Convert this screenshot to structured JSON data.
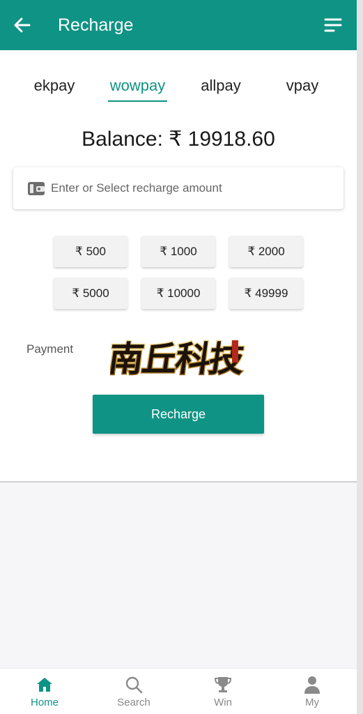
{
  "header": {
    "title": "Recharge",
    "back_icon": "arrow-left-icon",
    "menu_icon": "menu-lines-icon"
  },
  "tabs": [
    {
      "label": "ekpay",
      "active": false
    },
    {
      "label": "wowpay",
      "active": true
    },
    {
      "label": "allpay",
      "active": false
    },
    {
      "label": "vpay",
      "active": false
    }
  ],
  "balance": "Balance: ₹ 19918.60",
  "amount_input": {
    "placeholder": "Enter or Select recharge amount",
    "value": "",
    "icon": "wallet-icon"
  },
  "presets": [
    "₹ 500",
    "₹ 1000",
    "₹ 2000",
    "₹ 5000",
    "₹ 10000",
    "₹ 49999"
  ],
  "payment": {
    "label": "Payment",
    "logo_text": "南丘科技"
  },
  "recharge_button": "Recharge",
  "bottom_nav": [
    {
      "label": "Home",
      "icon": "home-icon",
      "active": true
    },
    {
      "label": "Search",
      "icon": "search-icon",
      "active": false
    },
    {
      "label": "Win",
      "icon": "trophy-icon",
      "active": false
    },
    {
      "label": "My",
      "icon": "person-icon",
      "active": false
    }
  ],
  "colors": {
    "primary": "#0f9384",
    "background": "#f6f6f8",
    "nav_inactive": "#888888"
  }
}
